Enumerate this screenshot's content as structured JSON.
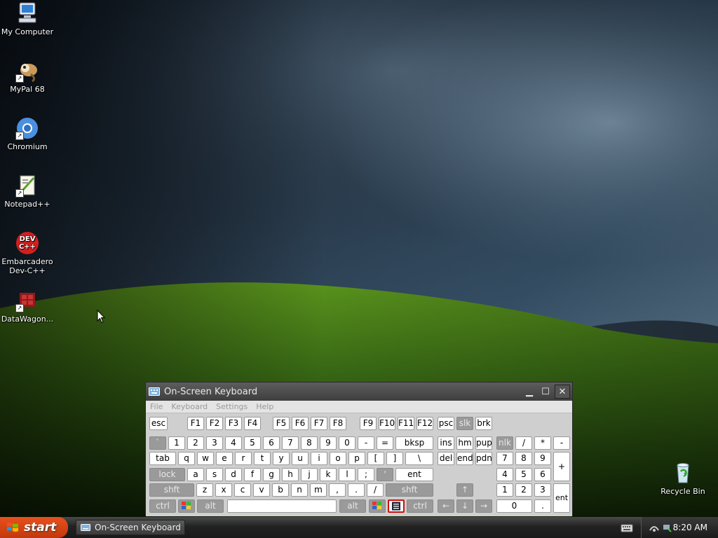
{
  "desktop": {
    "icons": [
      {
        "label": "My Computer",
        "icon": "computer-icon"
      },
      {
        "label": "MyPal 68",
        "icon": "mypal-icon"
      },
      {
        "label": "Chromium",
        "icon": "chromium-icon"
      },
      {
        "label": "Notepad++",
        "icon": "notepadpp-icon"
      },
      {
        "label": "Embarcadero Dev-C++",
        "icon": "devcpp-icon"
      },
      {
        "label": "DataWagon...",
        "icon": "datawagon-icon"
      },
      {
        "label": "Recycle Bin",
        "icon": "recycle-bin-icon"
      }
    ],
    "devcpp_badge": "DEV\nC++"
  },
  "osk": {
    "title": "On-Screen Keyboard",
    "menu": [
      "File",
      "Keyboard",
      "Settings",
      "Help"
    ],
    "rows": {
      "fn": [
        "esc",
        "F1",
        "F2",
        "F3",
        "F4",
        "F5",
        "F6",
        "F7",
        "F8",
        "F9",
        "F10",
        "F11",
        "F12",
        "psc",
        "slk",
        "brk"
      ],
      "num": [
        "`",
        "1",
        "2",
        "3",
        "4",
        "5",
        "6",
        "7",
        "8",
        "9",
        "0",
        "-",
        "=",
        "bksp",
        "ins",
        "hm",
        "pup",
        "nlk",
        "/",
        "*",
        "-"
      ],
      "top": [
        "tab",
        "q",
        "w",
        "e",
        "r",
        "t",
        "y",
        "u",
        "i",
        "o",
        "p",
        "[",
        "]",
        "\\",
        "del",
        "end",
        "pdn",
        "7",
        "8",
        "9",
        "+"
      ],
      "home": [
        "lock",
        "a",
        "s",
        "d",
        "f",
        "g",
        "h",
        "j",
        "k",
        "l",
        ";",
        "'",
        "ent",
        "4",
        "5",
        "6"
      ],
      "bottom": [
        "shft",
        "z",
        "x",
        "c",
        "v",
        "b",
        "n",
        "m",
        ",",
        ".",
        "/",
        "shft",
        "↑",
        "1",
        "2",
        "3",
        "ent"
      ],
      "space": [
        "ctrl",
        "",
        "alt",
        "",
        "alt",
        "",
        "",
        "ctrl",
        "←",
        "↓",
        "→",
        "0",
        "."
      ]
    }
  },
  "taskbar": {
    "start_label": "start",
    "window_button": "On-Screen Keyboard",
    "clock": "8:20 AM"
  },
  "colors": {
    "start": "#d5461a",
    "taskbar": "#222222",
    "osk_titlebar": "#4a4a4a",
    "key_dark": "#9a9a9a",
    "key_highlight": "#cc1111"
  }
}
